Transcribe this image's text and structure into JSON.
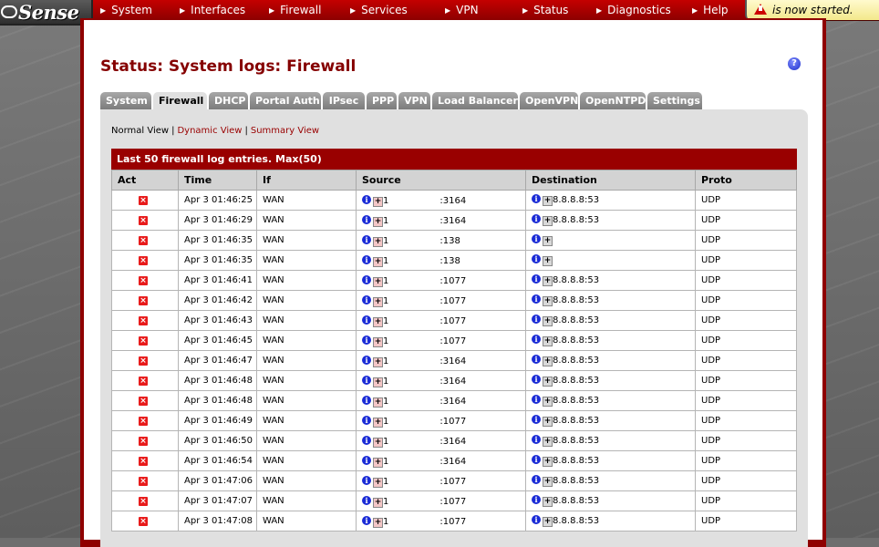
{
  "nav": {
    "logo": "Sense",
    "items": [
      "System",
      "Interfaces",
      "Firewall",
      "Services",
      "VPN",
      "Status",
      "Diagnostics",
      "Help"
    ],
    "notice": "is now started."
  },
  "page": {
    "title": "Status: System logs: Firewall",
    "help": "?"
  },
  "tabs": [
    "System",
    "Firewall",
    "DHCP",
    "Portal Auth",
    "IPsec",
    "PPP",
    "VPN",
    "Load Balancer",
    "OpenVPN",
    "OpenNTPD",
    "Settings"
  ],
  "active_tab": "Firewall",
  "views": {
    "normal": "Normal View",
    "dynamic": "Dynamic View",
    "summary": "Summary View"
  },
  "log": {
    "caption": "Last 50 firewall log entries. Max(50)",
    "headers": [
      "Act",
      "Time",
      "If",
      "Source",
      "Destination",
      "Proto"
    ],
    "rows": [
      {
        "time": "Apr 3 01:46:25",
        "if": "WAN",
        "src_prefix": "1",
        "src_port": ":3164",
        "dst": "8.8.8.8:53",
        "proto": "UDP"
      },
      {
        "time": "Apr 3 01:46:29",
        "if": "WAN",
        "src_prefix": "1",
        "src_port": ":3164",
        "dst": "8.8.8.8:53",
        "proto": "UDP"
      },
      {
        "time": "Apr 3 01:46:35",
        "if": "WAN",
        "src_prefix": "1",
        "src_port": ":138",
        "dst": "",
        "proto": "UDP"
      },
      {
        "time": "Apr 3 01:46:35",
        "if": "WAN",
        "src_prefix": "1",
        "src_port": ":138",
        "dst": "",
        "proto": "UDP"
      },
      {
        "time": "Apr 3 01:46:41",
        "if": "WAN",
        "src_prefix": "1",
        "src_port": ":1077",
        "dst": "8.8.8.8:53",
        "proto": "UDP"
      },
      {
        "time": "Apr 3 01:46:42",
        "if": "WAN",
        "src_prefix": "1",
        "src_port": ":1077",
        "dst": "8.8.8.8:53",
        "proto": "UDP"
      },
      {
        "time": "Apr 3 01:46:43",
        "if": "WAN",
        "src_prefix": "1",
        "src_port": ":1077",
        "dst": "8.8.8.8:53",
        "proto": "UDP"
      },
      {
        "time": "Apr 3 01:46:45",
        "if": "WAN",
        "src_prefix": "1",
        "src_port": ":1077",
        "dst": "8.8.8.8:53",
        "proto": "UDP"
      },
      {
        "time": "Apr 3 01:46:47",
        "if": "WAN",
        "src_prefix": "1",
        "src_port": ":3164",
        "dst": "8.8.8.8:53",
        "proto": "UDP"
      },
      {
        "time": "Apr 3 01:46:48",
        "if": "WAN",
        "src_prefix": "1",
        "src_port": ":3164",
        "dst": "8.8.8.8:53",
        "proto": "UDP"
      },
      {
        "time": "Apr 3 01:46:48",
        "if": "WAN",
        "src_prefix": "1",
        "src_port": ":3164",
        "dst": "8.8.8.8:53",
        "proto": "UDP"
      },
      {
        "time": "Apr 3 01:46:49",
        "if": "WAN",
        "src_prefix": "1",
        "src_port": ":1077",
        "dst": "8.8.8.8:53",
        "proto": "UDP"
      },
      {
        "time": "Apr 3 01:46:50",
        "if": "WAN",
        "src_prefix": "1",
        "src_port": ":3164",
        "dst": "8.8.8.8:53",
        "proto": "UDP"
      },
      {
        "time": "Apr 3 01:46:54",
        "if": "WAN",
        "src_prefix": "1",
        "src_port": ":3164",
        "dst": "8.8.8.8:53",
        "proto": "UDP"
      },
      {
        "time": "Apr 3 01:47:06",
        "if": "WAN",
        "src_prefix": "1",
        "src_port": ":1077",
        "dst": "8.8.8.8:53",
        "proto": "UDP"
      },
      {
        "time": "Apr 3 01:47:07",
        "if": "WAN",
        "src_prefix": "1",
        "src_port": ":1077",
        "dst": "8.8.8.8:53",
        "proto": "UDP"
      },
      {
        "time": "Apr 3 01:47:08",
        "if": "WAN",
        "src_prefix": "1",
        "src_port": ":1077",
        "dst": "8.8.8.8:53",
        "proto": "UDP"
      }
    ]
  },
  "icons": {
    "action": "block-icon",
    "info": "info-icon",
    "add_rule": "plus-icon"
  },
  "colors": {
    "brand_red": "#990000",
    "title_red": "#850000",
    "tab_inactive": "#8c8c8c",
    "tab_active": "#e0e0e0",
    "block_red": "#e81b1b",
    "info_blue": "#1a2bd6"
  }
}
